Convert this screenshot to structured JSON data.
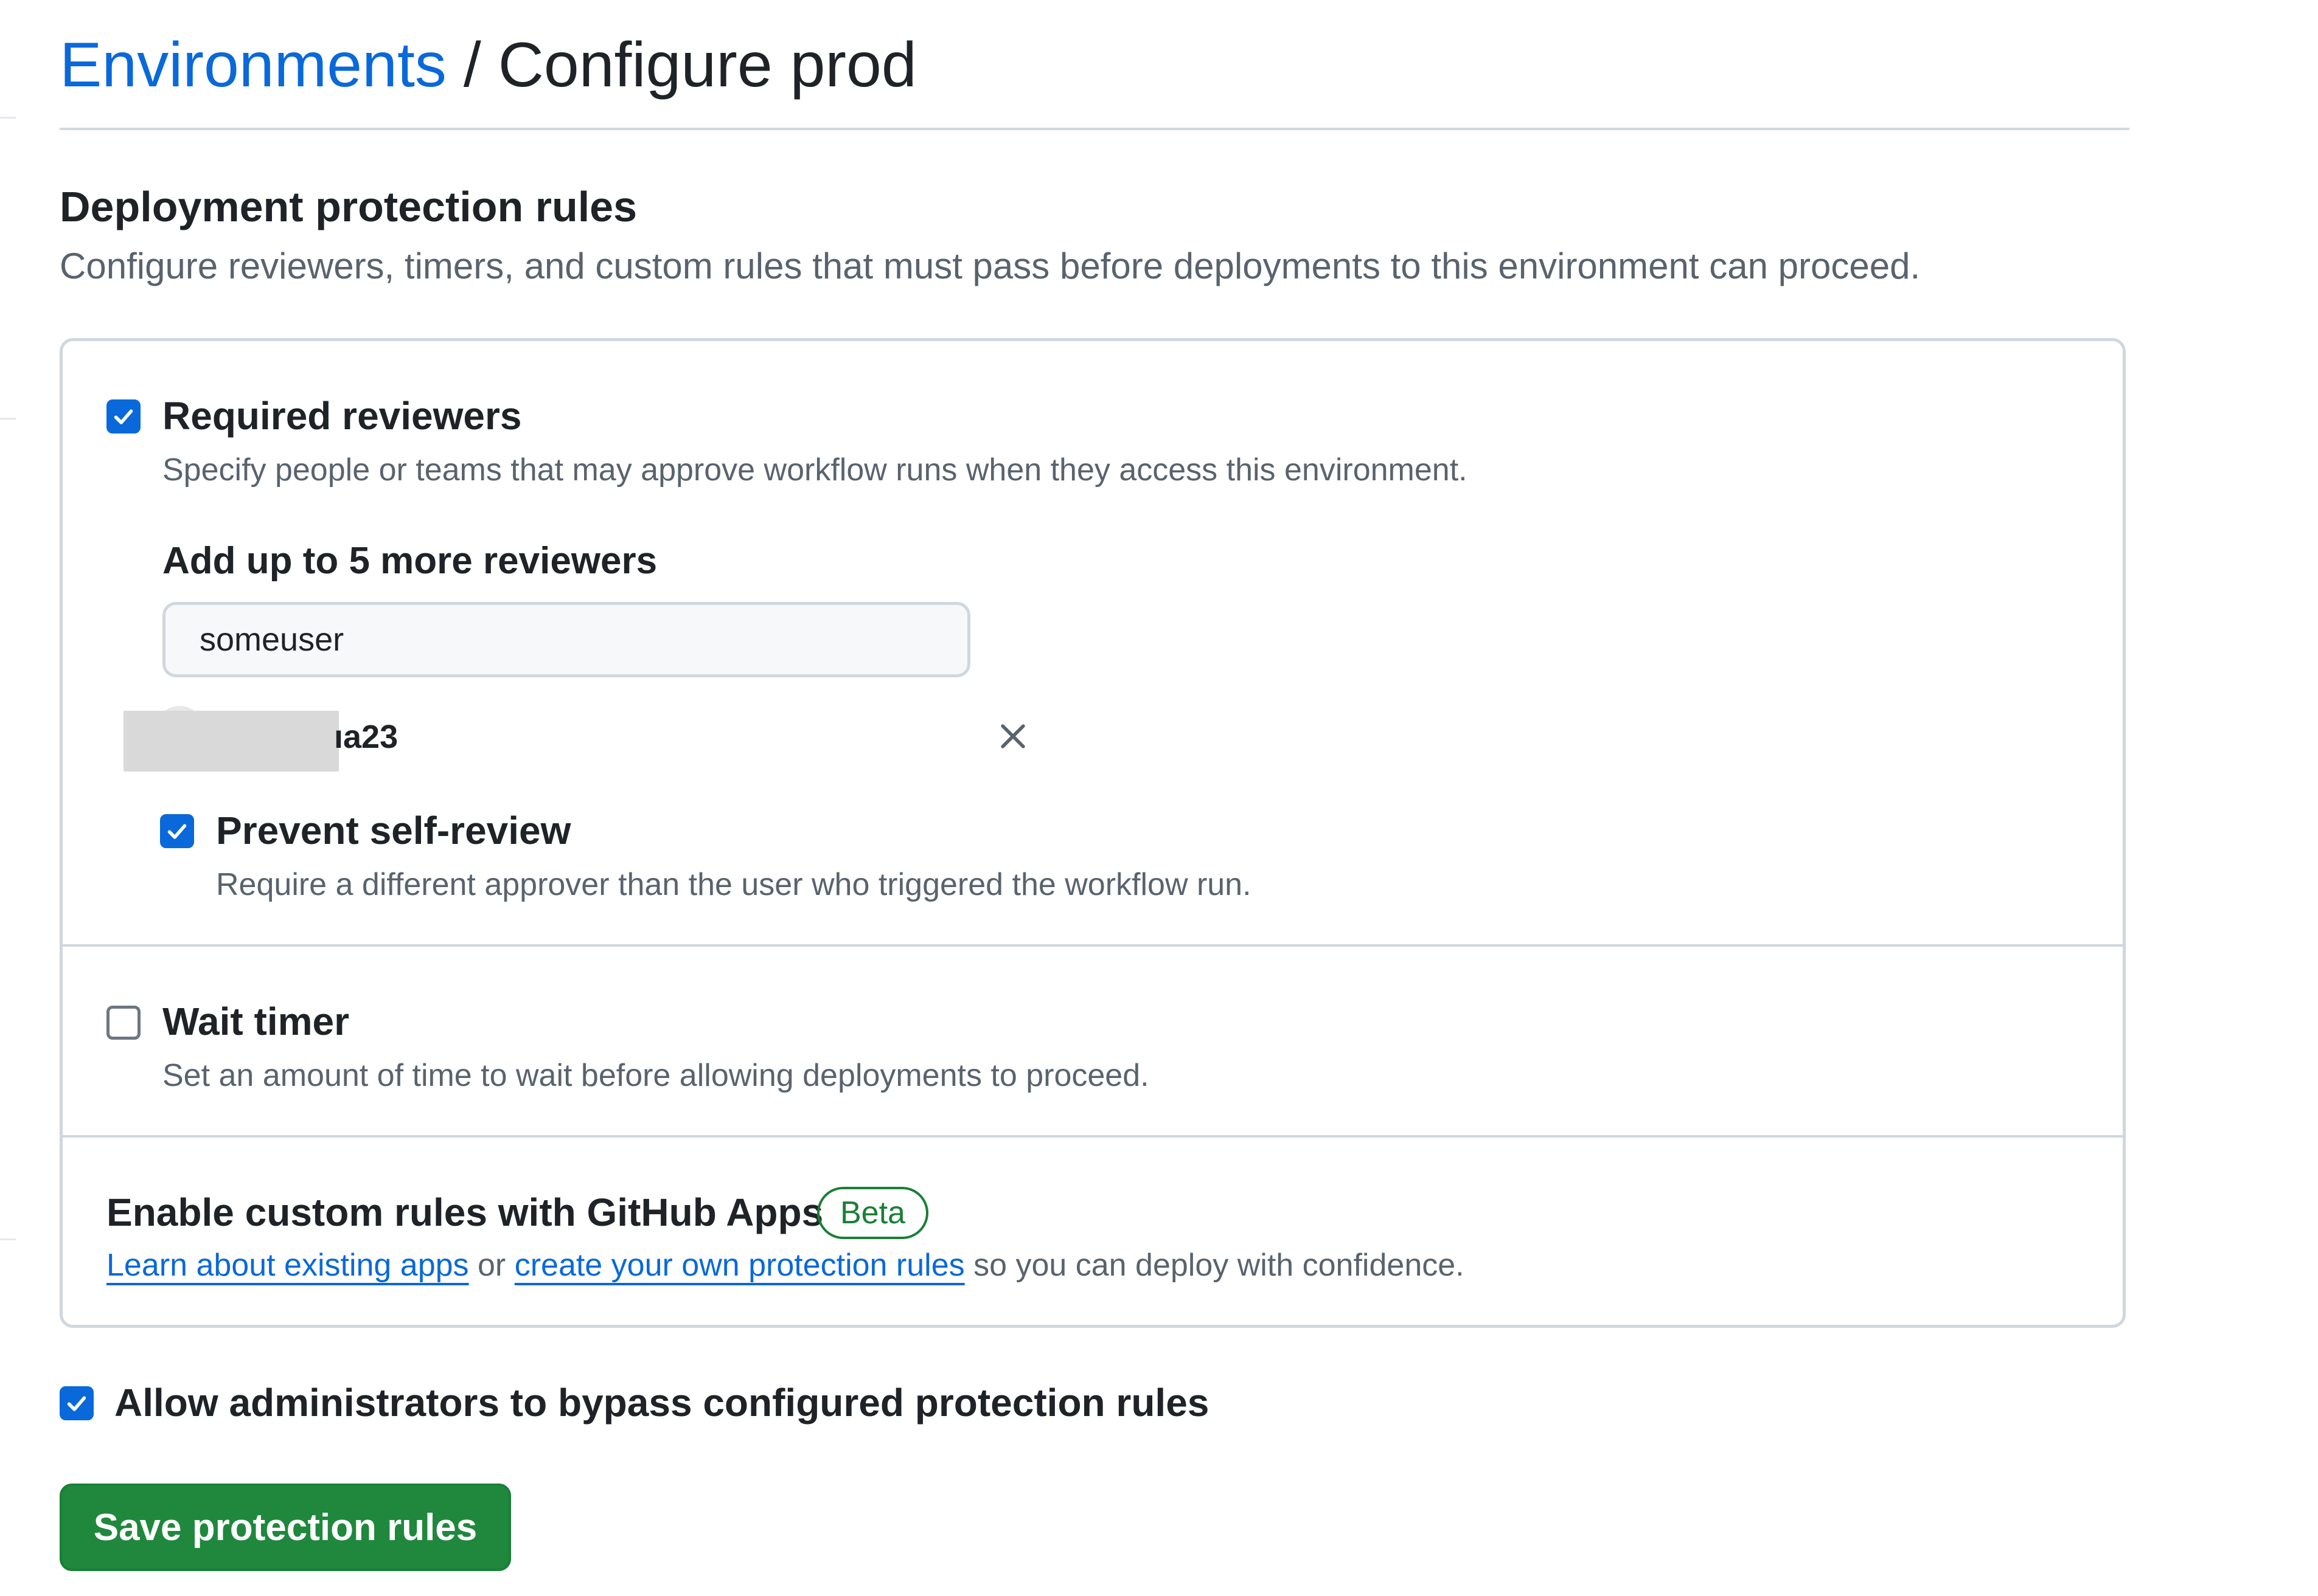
{
  "breadcrumb": {
    "parent_label": "Environments",
    "separator": "/",
    "current_label": "Configure prod"
  },
  "section": {
    "title": "Deployment protection rules",
    "description": "Configure reviewers, timers, and custom rules that must pass before deployments to this environment can proceed."
  },
  "required_reviewers": {
    "checked": true,
    "label": "Required reviewers",
    "description": "Specify people or teams that may approve workflow runs when they access this environment.",
    "add_label": "Add up to 5 more reviewers",
    "input_value": "someuser",
    "reviewers": [
      {
        "name_visible": "ıa23",
        "avatar": "redacted",
        "remove_icon": "close-icon"
      }
    ],
    "prevent_self_review": {
      "checked": true,
      "label": "Prevent self-review",
      "description": "Require a different approver than the user who triggered the workflow run."
    }
  },
  "wait_timer": {
    "checked": false,
    "label": "Wait timer",
    "description": "Set an amount of time to wait before allowing deployments to proceed."
  },
  "custom_rules": {
    "title": "Enable custom rules with GitHub Apps",
    "badge": "Beta",
    "link_existing": "Learn about existing apps",
    "connector": "or",
    "link_create": "create your own protection rules",
    "suffix": "so you can deploy with confidence."
  },
  "bypass": {
    "checked": true,
    "label": "Allow administrators to bypass configured protection rules"
  },
  "save_button_label": "Save protection rules",
  "colors": {
    "link": "#0969da",
    "checkbox": "#0969da",
    "primary_button": "#1f883d",
    "badge": "#1a7f37",
    "border": "#d0d7de",
    "muted_text": "#59636e"
  }
}
